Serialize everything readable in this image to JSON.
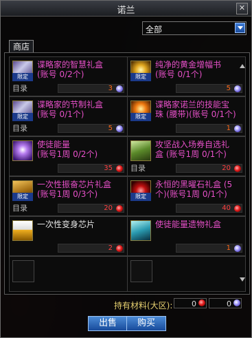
{
  "window": {
    "title": "诺兰",
    "close_glyph": "✕"
  },
  "filter": {
    "selected": "全部"
  },
  "tab": {
    "label": "商店"
  },
  "items": [
    {
      "name": "谍略家的智慧礼盒\n(账号 0/2个)",
      "badge": "限定",
      "catalog": "目录",
      "price": "3",
      "currency": "blue",
      "icon": "scroll-gift-icon",
      "name_color": "pink"
    },
    {
      "name": "纯净的黄金增幅书\n(账号 0/1个)",
      "badge": "限定",
      "catalog": "",
      "price": "5",
      "currency": "blue",
      "icon": "gold-book-icon",
      "name_color": "pink"
    },
    {
      "name": "谍略家的节制礼盒\n(账号 0/1个)",
      "badge": "限定",
      "catalog": "目录",
      "price": "5",
      "currency": "blue",
      "icon": "scroll-gift-icon",
      "name_color": "pink"
    },
    {
      "name": "谍略家诺兰的技能宝\n珠 (腰带)(账号 0/1个)",
      "badge": "限定",
      "catalog": "",
      "price": "1",
      "currency": "blue",
      "icon": "skill-orb-icon",
      "name_color": "pink"
    },
    {
      "name": "使徒能量\n(账号1周 0/2个)",
      "badge": "",
      "catalog": "",
      "price": "35",
      "currency": "red",
      "icon": "apostle-energy-icon",
      "name_color": "pink"
    },
    {
      "name": "攻坚战入场券自选礼\n盒 (账号1周 0/1个)",
      "badge": "",
      "catalog": "目录",
      "price": "20",
      "currency": "red",
      "icon": "ticket-box-icon",
      "name_color": "pink"
    },
    {
      "name": "一次性振奋芯片礼盒\n(账号1周 0/3个)",
      "badge": "限定",
      "catalog": "目录",
      "price": "20",
      "currency": "red",
      "icon": "chip-chest-icon",
      "name_color": "pink"
    },
    {
      "name": "永恒的黑曜石礼盒 (5\n个)(账号1周 0/1个)",
      "badge": "限定",
      "catalog": "",
      "price": "40",
      "currency": "red",
      "icon": "obsidian-box-icon",
      "name_color": "pink"
    },
    {
      "name": "一次性变身芯片",
      "badge": "",
      "catalog": "",
      "price": "2",
      "currency": "red",
      "icon": "transform-chip-icon",
      "name_color": "white"
    },
    {
      "name": "使徒能量遗物礼盒",
      "badge": "",
      "catalog": "",
      "price": "1",
      "currency": "blue",
      "icon": "relic-box-icon",
      "name_color": "pink"
    }
  ],
  "footer": {
    "label": "持有材料(大区):",
    "red_amount": "0",
    "blue_amount": "0",
    "sell_label": "出售",
    "buy_label": "购买"
  }
}
